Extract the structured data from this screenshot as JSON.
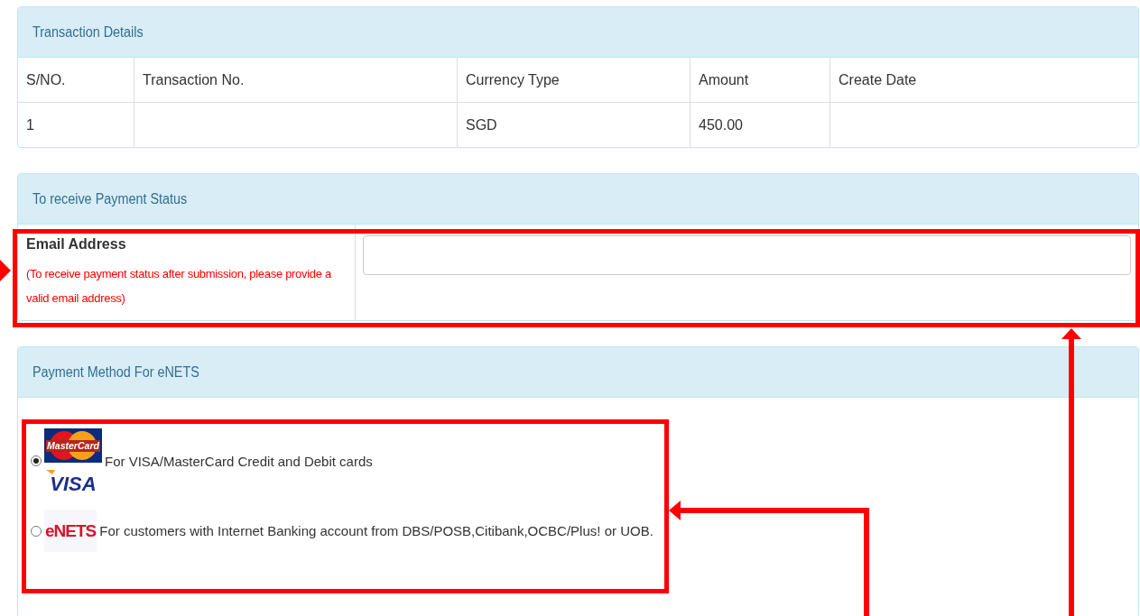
{
  "transaction_details": {
    "title": "Transaction Details",
    "columns": [
      "S/NO.",
      "Transaction No.",
      "Currency Type",
      "Amount",
      "Create Date"
    ],
    "rows": [
      [
        "1",
        "",
        "SGD",
        "450.00",
        ""
      ]
    ]
  },
  "payment_status": {
    "title": "To receive Payment Status",
    "label": "Email Address",
    "hint": "(To receive payment status after submission, please provide a valid email address)"
  },
  "payment_method": {
    "title": "Payment Method For eNETS",
    "options": [
      {
        "kind": "card",
        "logo_text": [
          "MasterCard",
          "VISA"
        ],
        "label": "For VISA/MasterCard Credit and Debit cards",
        "selected": true
      },
      {
        "kind": "enets",
        "logo_text": [
          "eNETS"
        ],
        "label": "For customers with Internet Banking account from DBS/POSB,Citibank,OCBC/Plus! or UOB.",
        "selected": false
      }
    ]
  }
}
